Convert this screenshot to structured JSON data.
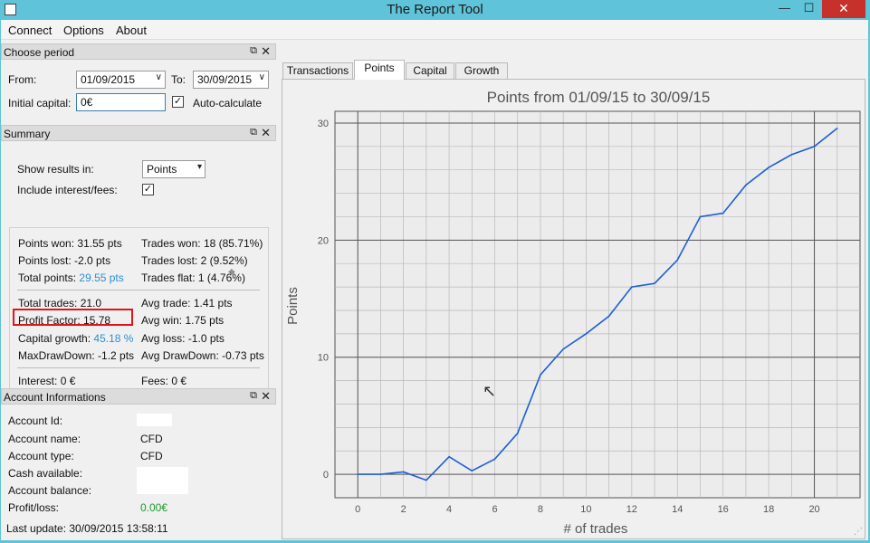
{
  "window": {
    "title": "The Report Tool",
    "min": "—",
    "max": "☐",
    "close": "✕"
  },
  "menu": [
    "Connect",
    "Options",
    "About"
  ],
  "period": {
    "header": "Choose period",
    "from_label": "From:",
    "from_value": "01/09/2015",
    "to_label": "To:",
    "to_value": "30/09/2015",
    "capital_label": "Initial capital:",
    "capital_value": "0€",
    "auto_label": "Auto-calculate",
    "auto_checked": true
  },
  "summary": {
    "header": "Summary",
    "show_results_label": "Show results in:",
    "show_results_value": "Points",
    "interest_label": "Include interest/fees:",
    "interest_checked": true,
    "points_won_label": "Points won:",
    "points_won_value": "31.55 pts",
    "points_lost_label": "Points lost:",
    "points_lost_value": "-2.0 pts",
    "total_points_label": "Total points:",
    "total_points_value": "29.55 pts",
    "trades_won_label": "Trades won:",
    "trades_won_value": "18 (85.71%)",
    "trades_lost_label": "Trades lost:",
    "trades_lost_value": "2 (9.52%)",
    "trades_flat_label": "Trades flat:",
    "trades_flat_value": "1 (4.76%)",
    "total_trades_label": "Total trades:",
    "total_trades_value": "21.0",
    "profit_factor_label": "Profit Factor:",
    "profit_factor_value": "15.78",
    "capital_growth_label": "Capital growth:",
    "capital_growth_value": "45.18 %",
    "maxdd_label": "MaxDrawDown:",
    "maxdd_value": "-1.2 pts",
    "avg_trade_label": "Avg trade:",
    "avg_trade_value": "1.41 pts",
    "avg_win_label": "Avg win:",
    "avg_win_value": "1.75 pts",
    "avg_loss_label": "Avg loss:",
    "avg_loss_value": "-1.0 pts",
    "avg_dd_label": "Avg DrawDown:",
    "avg_dd_value": "-0.73 pts",
    "interest_res_label": "Interest:",
    "interest_res_value": "0 €",
    "fees_label": "Fees:",
    "fees_value": "0 €"
  },
  "account": {
    "header": "Account Informations",
    "id_label": "Account Id:",
    "id_value": "",
    "name_label": "Account name:",
    "name_value": "CFD",
    "type_label": "Account type:",
    "type_value": "CFD",
    "cash_label": "Cash available:",
    "cash_value": "",
    "balance_label": "Account balance:",
    "balance_value": "",
    "pnl_label": "Profit/loss:",
    "pnl_value": "0.00€"
  },
  "tabs": [
    "Transactions",
    "Points",
    "Capital",
    "Growth"
  ],
  "active_tab": "Points",
  "status": {
    "last_update": "Last update: 30/09/2015 13:58:11"
  },
  "colors": {
    "accent": "#2e8fd0",
    "line": "#1f5fd6",
    "highlight": "#e0141e",
    "profit": "#1a9a2a",
    "titlebar": "#5fc3d9"
  },
  "chart_data": {
    "type": "line",
    "title": "Points from 01/09/15 to 30/09/15",
    "xlabel": "# of trades",
    "ylabel": "Points",
    "xlim": [
      -1,
      22
    ],
    "ylim": [
      -2,
      31
    ],
    "xticks": [
      0,
      2,
      4,
      6,
      8,
      10,
      12,
      14,
      16,
      18,
      20
    ],
    "yticks": [
      0,
      10,
      20,
      30
    ],
    "grid": true,
    "x": [
      0,
      1,
      2,
      3,
      4,
      5,
      6,
      7,
      8,
      9,
      10,
      11,
      12,
      13,
      14,
      15,
      16,
      17,
      18,
      19,
      20,
      21
    ],
    "values": [
      0,
      0,
      0.2,
      -0.5,
      1.5,
      0.3,
      1.3,
      3.5,
      8.5,
      10.7,
      12.0,
      13.5,
      16.0,
      16.3,
      18.3,
      22.0,
      22.3,
      24.7,
      26.2,
      27.3,
      28.0,
      29.55
    ]
  }
}
